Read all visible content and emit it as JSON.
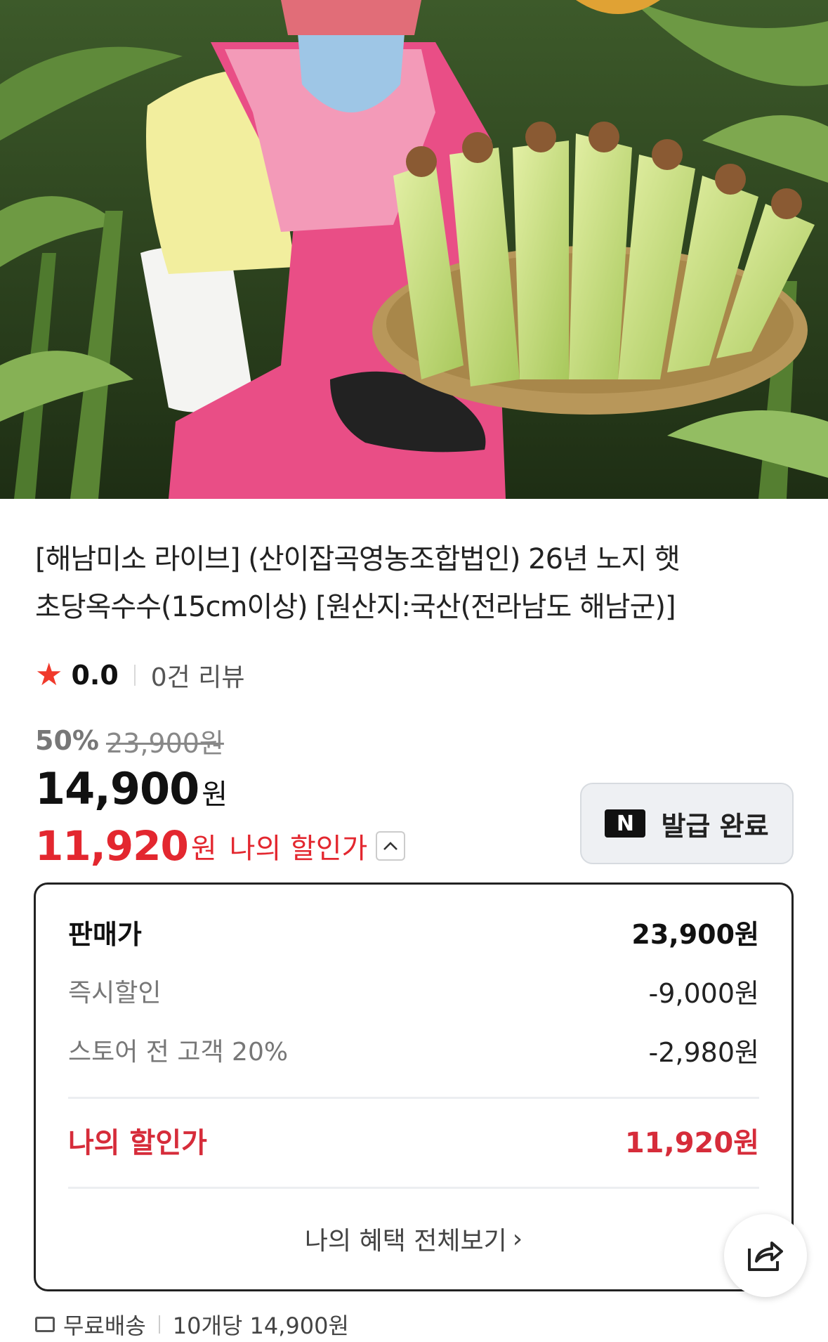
{
  "product": {
    "title_line1": "[해남미소 라이브] (산이잡곡영농조합법인) 26년 노지 햇",
    "title_line2": "초당옥수수(15cm이상) [원산지:국산(전라남도 해남군)]"
  },
  "rating": {
    "star_icon": "star-icon",
    "score": "0.0",
    "reviews": "0건 리뷰"
  },
  "price": {
    "discount_percent": "50%",
    "original": "23,900원",
    "sale_number": "14,900",
    "sale_unit": "원",
    "my_price_number": "11,920",
    "my_price_unit": "원",
    "my_price_label": "나의 할인가"
  },
  "coupon": {
    "badge": "N",
    "label": "발급 완료"
  },
  "breakdown": {
    "rows": [
      {
        "label": "판매가",
        "value": "23,900원"
      },
      {
        "label": "즉시할인",
        "value": "-9,000원"
      },
      {
        "label": "스토어 전 고객 20%",
        "value": "-2,980원"
      }
    ],
    "total_label": "나의 할인가",
    "total_value": "11,920원",
    "more_label": "나의 혜택 전체보기",
    "more_chevron": "›"
  },
  "shipping": {
    "label": "무료배송",
    "unit_price": "10개당 14,900원"
  },
  "colors": {
    "accent_red": "#e3272f",
    "star": "#f0392b"
  }
}
